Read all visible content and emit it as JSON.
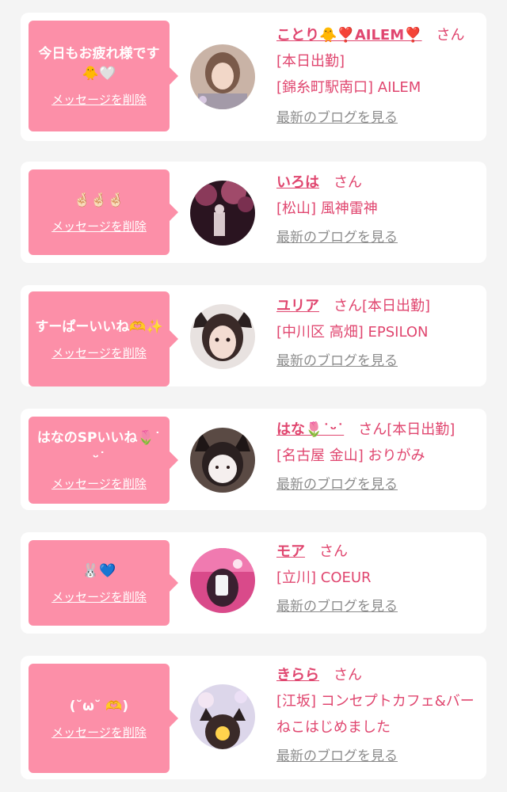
{
  "colors": {
    "page_bg": "#f4f4f4",
    "card_bg": "#ffffff",
    "bubble_bg": "#fc8fa8",
    "accent_pink": "#e0466f",
    "link_gray": "#8c8c8c"
  },
  "cards": [
    {
      "message": "今日もお疲れ様です🐥🤍",
      "delete_label": "メッセージを削除",
      "name": "ことり🐥❣️AILEM❣️",
      "honorific": "さん",
      "status": "[本日出勤]",
      "shop": "[錦糸町駅南口] AILEM",
      "blog_link": "最新のブログを見る",
      "avatar_icon": "girl-photo-avatar"
    },
    {
      "message": "🤞🏻🤞🏻🤞🏻",
      "delete_label": "メッセージを削除",
      "name": "いろは",
      "honorific": "さん",
      "status": "",
      "shop": "[松山] 風神雷神",
      "blog_link": "最新のブログを見る",
      "avatar_icon": "night-cherry-blossom-avatar"
    },
    {
      "message": "すーぱーいいね🫶✨",
      "delete_label": "メッセージを削除",
      "name": "ユリア",
      "honorific": "さん",
      "status": "[本日出勤]",
      "shop": "[中川区 高畑] EPSILON",
      "blog_link": "最新のブログを見る",
      "avatar_icon": "cat-ears-girl-avatar"
    },
    {
      "message": "はなのSPいいね🌷˙ᵕ˙",
      "delete_label": "メッセージを削除",
      "name": "はな🌷˙ᵕ˙",
      "honorific": "さん",
      "status": "[本日出勤]",
      "shop": "[名古屋 金山] おりがみ",
      "blog_link": "最新のブログを見る",
      "avatar_icon": "cat-filter-girl-avatar"
    },
    {
      "message": "🐰💙",
      "delete_label": "メッセージを削除",
      "name": "モア",
      "honorific": "さん",
      "status": "",
      "shop": "[立川] COEUR",
      "blog_link": "最新のブログを見る",
      "avatar_icon": "pink-mirror-selfie-avatar"
    },
    {
      "message": "(˘ω˘ 🫶)",
      "delete_label": "メッセージを削除",
      "name": "きらら",
      "honorific": "さん",
      "status": "",
      "shop": "[江坂] コンセプトカフェ&バー　ねこはじめました",
      "blog_link": "最新のブログを見る",
      "avatar_icon": "cat-ears-sticker-avatar"
    }
  ]
}
